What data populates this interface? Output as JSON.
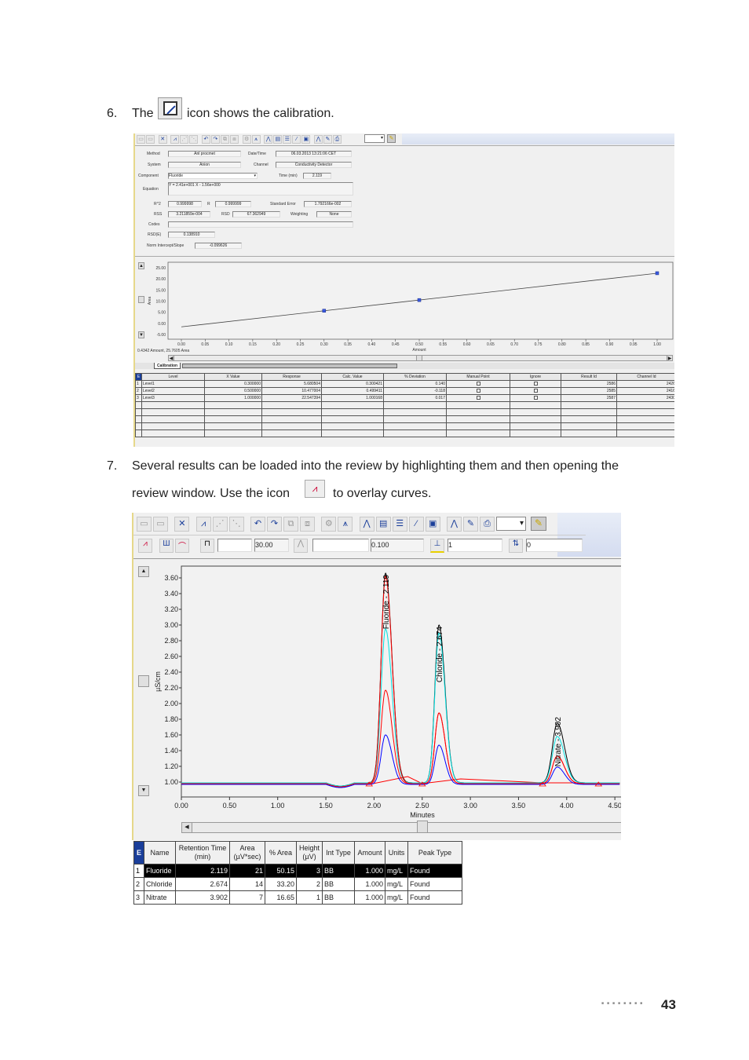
{
  "step6": {
    "number": "6.",
    "before": "The",
    "after": "icon shows the calibration.",
    "icon": "calibration-icon"
  },
  "step7": {
    "number": "7.",
    "line1": "Several results can be loaded into the review by highlighting them and then opening the",
    "line2_before": "review window. Use the icon",
    "line2_after": "to overlay curves.",
    "icon": "overlay-icon"
  },
  "calib_window": {
    "toolbar_icons": [
      "save",
      "save-as",
      "tools",
      "overlay",
      "edit-peak",
      "zoom-peak",
      "undo",
      "redo",
      "copy",
      "paste",
      "integrate",
      "baseline",
      "chromatogram",
      "report",
      "table",
      "calibration",
      "document",
      "spectrum",
      "manual",
      "print"
    ],
    "form": {
      "method_label": "Method",
      "method": "Anl procmet",
      "datetime_label": "Date/Time",
      "datetime": "06.03.2013 13:21:06 CET",
      "system_label": "System",
      "system": "Anion",
      "channel_label": "Channel",
      "channel": "Conductivity Detector",
      "component_label": "Component",
      "component": "Fluoride",
      "time_label": "Time (min)",
      "time": "2.119",
      "equation_label": "Equation",
      "equation": "Y = 2.41e+001 X - 1.56e+000",
      "r2_label": "R^2",
      "r2": "0.999998",
      "r_label": "R",
      "r": "0.999999",
      "stderr_label": "Standard Error",
      "stderr": "1.792166e-002",
      "rss_label": "RSS",
      "rss": "3.211859e-004",
      "rsd_label": "RSD",
      "rsd": "67.362949",
      "weighting_label": "Weighting",
      "weighting": "None",
      "codes_label": "Codes",
      "codes": "",
      "rsde_label": "RSD(E)",
      "rsde": "0.138910",
      "norm_label": "Norm Intercept/Slope",
      "norm": "-0.099626"
    },
    "status": "0.4342 Amount, 25.7605 Area",
    "tab": "Calibration",
    "table": {
      "headers": [
        "Level",
        "X Value",
        "Response",
        "Calc. Value",
        "% Deviation",
        "Manual Point",
        "Ignore",
        "Result Id",
        "Channel Id"
      ],
      "rows": [
        [
          "Level1",
          "0.300000",
          "5.680504",
          "0.300421",
          "0.140",
          "",
          "",
          "2586",
          "2426"
        ],
        [
          "Level2",
          "0.500000",
          "10.477004",
          "0.499411",
          "-0.118",
          "",
          "",
          "2585",
          "2416"
        ],
        [
          "Level3",
          "1.000000",
          "22.547394",
          "1.000168",
          "0.017",
          "",
          "",
          "2587",
          "2430"
        ]
      ]
    }
  },
  "chart_data": [
    {
      "type": "scatter",
      "xlabel": "Amount",
      "ylabel": "Area",
      "xlim": [
        0,
        1
      ],
      "ylim": [
        -5,
        25
      ],
      "xticks": [
        "0.00",
        "0.05",
        "0.10",
        "0.15",
        "0.20",
        "0.25",
        "0.30",
        "0.35",
        "0.40",
        "0.45",
        "0.50",
        "0.55",
        "0.60",
        "0.65",
        "0.70",
        "0.75",
        "0.80",
        "0.85",
        "0.90",
        "0.95",
        "1.00"
      ],
      "yticks": [
        "25.00",
        "20.00",
        "15.00",
        "10.00",
        "5.00",
        "0.00",
        "-5.00"
      ],
      "points": [
        {
          "x": 0.3,
          "y": 5.6805
        },
        {
          "x": 0.5,
          "y": 10.477
        },
        {
          "x": 1.0,
          "y": 22.5474
        }
      ],
      "fit": {
        "slope": 24.1,
        "intercept": -1.56
      },
      "colors": {
        "point": "#3a5adf",
        "line": "#444444"
      }
    },
    {
      "type": "line",
      "xlabel": "Minutes",
      "ylabel": "µS/cm",
      "xlim": [
        0,
        4.55
      ],
      "ylim": [
        0.9,
        3.7
      ],
      "xticks": [
        "0.00",
        "0.50",
        "1.00",
        "1.50",
        "2.00",
        "2.50",
        "3.00",
        "3.50",
        "4.00",
        "4.50"
      ],
      "yticks": [
        "3.60",
        "3.40",
        "3.20",
        "3.00",
        "2.80",
        "2.60",
        "2.40",
        "2.20",
        "2.00",
        "1.80",
        "1.60",
        "1.40",
        "1.20",
        "1.00"
      ],
      "peaks": [
        {
          "label": "Fluoride - 2.119",
          "time": 2.119,
          "width": 0.045
        },
        {
          "label": "Chloride - 2.674",
          "time": 2.674,
          "width": 0.042
        },
        {
          "label": "Nitrate - 3.902",
          "time": 3.902,
          "width": 0.05
        }
      ],
      "series": [
        {
          "color": "#000000",
          "baseline": 0.99,
          "heights": [
            3.66,
            3.0,
            1.75
          ]
        },
        {
          "color": "#00e0e0",
          "baseline": 0.99,
          "heights": [
            2.95,
            2.9,
            1.58
          ]
        },
        {
          "color": "#ff0000",
          "baseline": 0.98,
          "heights": [
            3.62,
            1.88,
            1.33
          ]
        },
        {
          "color": "#ff0000",
          "baseline": 0.98,
          "heights": [
            2.17,
            1.88,
            1.33
          ]
        },
        {
          "color": "#0000ff",
          "baseline": 0.97,
          "heights": [
            1.6,
            1.47,
            1.19
          ]
        }
      ]
    }
  ],
  "review_window": {
    "toolbar1_icons": [
      "save",
      "save-as",
      "tools",
      "overlay",
      "edit-peak",
      "zoom-peak",
      "undo",
      "redo",
      "copy",
      "paste",
      "integrate",
      "baseline",
      "chromatogram",
      "report",
      "table",
      "calibration",
      "document",
      "spectrum",
      "manual",
      "print"
    ],
    "toolbar2": {
      "start_time": "",
      "end_time": "30.00",
      "threshold": "",
      "threshold_value": "0.100",
      "peak_width": "1",
      "offset": "0"
    },
    "table": {
      "corner": "E",
      "headers": [
        "Name",
        "Retention Time (min)",
        "Area (µV*sec)",
        "% Area",
        "Height (µV)",
        "Int Type",
        "Amount",
        "Units",
        "Peak Type"
      ],
      "rows": [
        [
          "Fluoride",
          "2.119",
          "21",
          "50.15",
          "3",
          "BB",
          "1.000",
          "mg/L",
          "Found"
        ],
        [
          "Chloride",
          "2.674",
          "14",
          "33.20",
          "2",
          "BB",
          "1.000",
          "mg/L",
          "Found"
        ],
        [
          "Nitrate",
          "3.902",
          "7",
          "16.65",
          "1",
          "BB",
          "1.000",
          "mg/L",
          "Found"
        ]
      ]
    }
  },
  "footer": {
    "dots": "■■■■■■■■",
    "page": "43"
  }
}
